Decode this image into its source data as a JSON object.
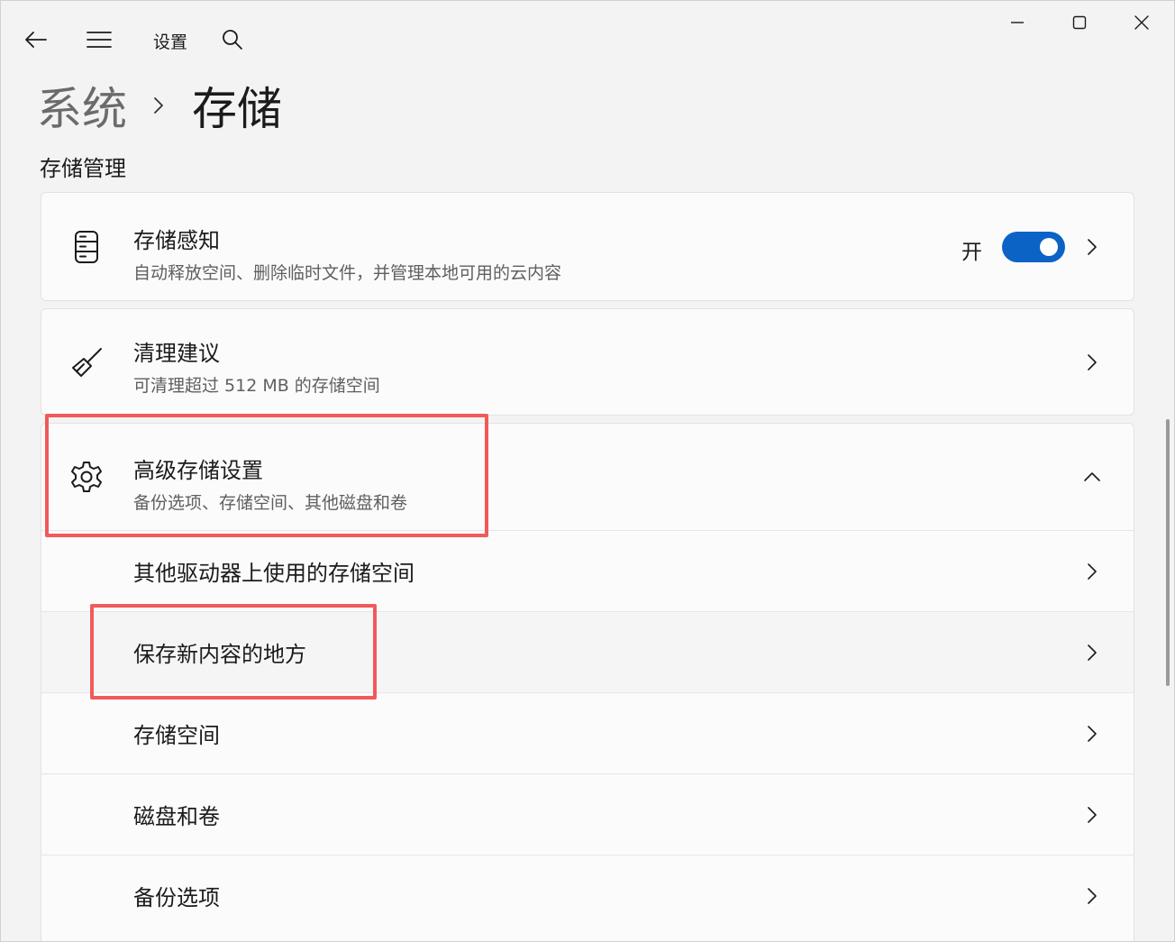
{
  "app": {
    "title": "设置"
  },
  "breadcrumb": {
    "parent": "系统",
    "current": "存储"
  },
  "section": {
    "title": "存储管理"
  },
  "storage_sense": {
    "title": "存储感知",
    "subtitle": "自动释放空间、删除临时文件，并管理本地可用的云内容",
    "toggle_label": "开",
    "toggle_on": true,
    "icon": "storage-drive-icon"
  },
  "cleanup": {
    "title": "清理建议",
    "subtitle": "可清理超过 512 MB 的存储空间",
    "icon": "broom-icon"
  },
  "advanced": {
    "title": "高级存储设置",
    "subtitle": "备份选项、存储空间、其他磁盘和卷",
    "icon": "gear-icon",
    "items": [
      {
        "label": "其他驱动器上使用的存储空间"
      },
      {
        "label": "保存新内容的地方"
      },
      {
        "label": "存储空间"
      },
      {
        "label": "磁盘和卷"
      },
      {
        "label": "备份选项"
      }
    ]
  },
  "colors": {
    "accent": "#0b63c6",
    "highlight": "#f15a5a"
  }
}
